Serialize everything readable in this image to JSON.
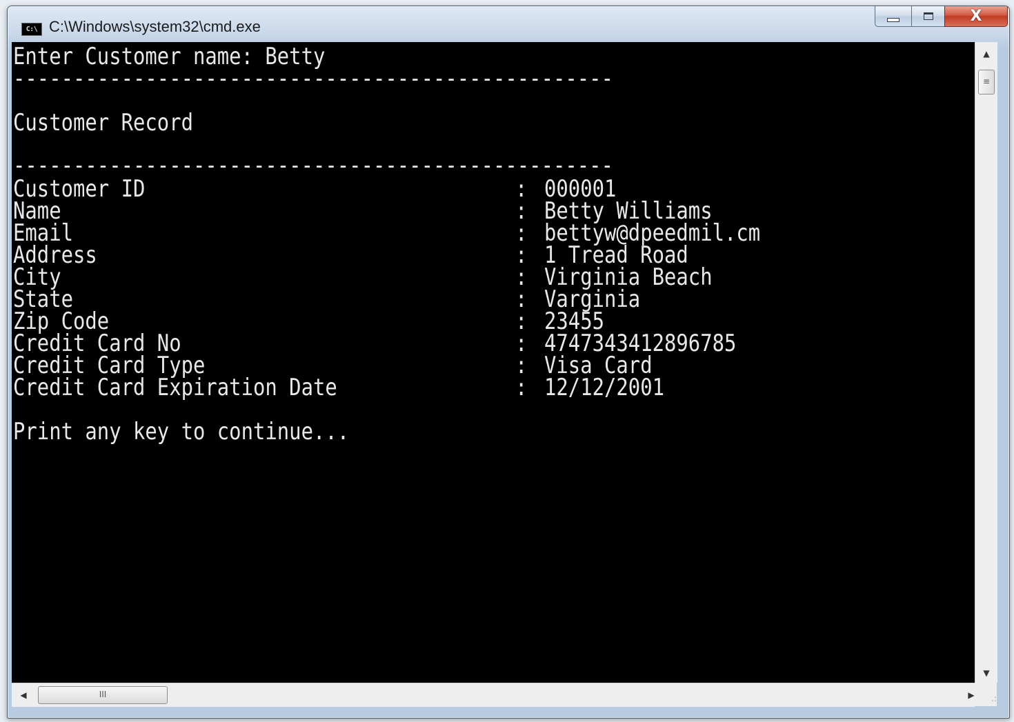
{
  "window": {
    "title": "C:\\Windows\\system32\\cmd.exe",
    "icon_label": "C:\\",
    "icons": {
      "app": "cmd-icon",
      "minimize": "minimize-icon",
      "maximize": "maximize-icon",
      "close": "close-icon"
    },
    "close_glyph": "X"
  },
  "console": {
    "prompt_line": "Enter Customer name: Betty",
    "separator_top": "--------------------------------------------------",
    "heading": "Customer Record",
    "separator_bottom": "--------------------------------------------------",
    "separator_char": ":",
    "fields": [
      {
        "label": "Customer ID",
        "value": "000001"
      },
      {
        "label": "Name",
        "value": "Betty Williams"
      },
      {
        "label": "Email",
        "value": "bettyw@dpeedmil.cm"
      },
      {
        "label": "Address",
        "value": "1 Tread Road"
      },
      {
        "label": "City",
        "value": "Virginia Beach"
      },
      {
        "label": "State",
        "value": "Varginia"
      },
      {
        "label": "Zip Code",
        "value": "23455"
      },
      {
        "label": "Credit Card No",
        "value": "4747343412896785"
      },
      {
        "label": "Credit Card Type",
        "value": "Visa Card"
      },
      {
        "label": "Credit Card Expiration Date",
        "value": "12/12/2001"
      }
    ],
    "continue_prompt": "Print any key to continue..."
  },
  "scrollbars": {
    "up_glyph": "▲",
    "down_glyph": "▼",
    "left_glyph": "◀",
    "right_glyph": "▶",
    "v_thumb_glyph": "≡",
    "h_thumb_glyph": "III",
    "grip_glyph": ".:"
  }
}
